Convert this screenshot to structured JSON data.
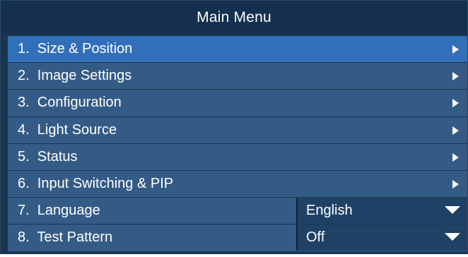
{
  "menu": {
    "title": "Main Menu",
    "selected_index": 0,
    "items": [
      {
        "label": "1.  Size & Position",
        "arrow": "right-arrow-icon"
      },
      {
        "label": "2.  Image Settings",
        "arrow": "right-arrow-icon"
      },
      {
        "label": "3.  Configuration",
        "arrow": "right-arrow-icon"
      },
      {
        "label": "4.  Light Source",
        "arrow": "right-arrow-icon"
      },
      {
        "label": "5.  Status",
        "arrow": "right-arrow-icon"
      },
      {
        "label": "6.  Input Switching & PIP",
        "arrow": "right-arrow-icon"
      },
      {
        "label": "7.  Language",
        "value": "English",
        "caret": "dropdown-caret-icon"
      },
      {
        "label": "8.  Test Pattern",
        "value": "Off",
        "caret": "dropdown-caret-icon"
      }
    ]
  },
  "colors": {
    "background": "#1b3550",
    "title_bar": "#15304e",
    "row": "#345b85",
    "row_selected": "#3170b8",
    "dropdown": "#1f4166",
    "text": "#ffffff"
  }
}
